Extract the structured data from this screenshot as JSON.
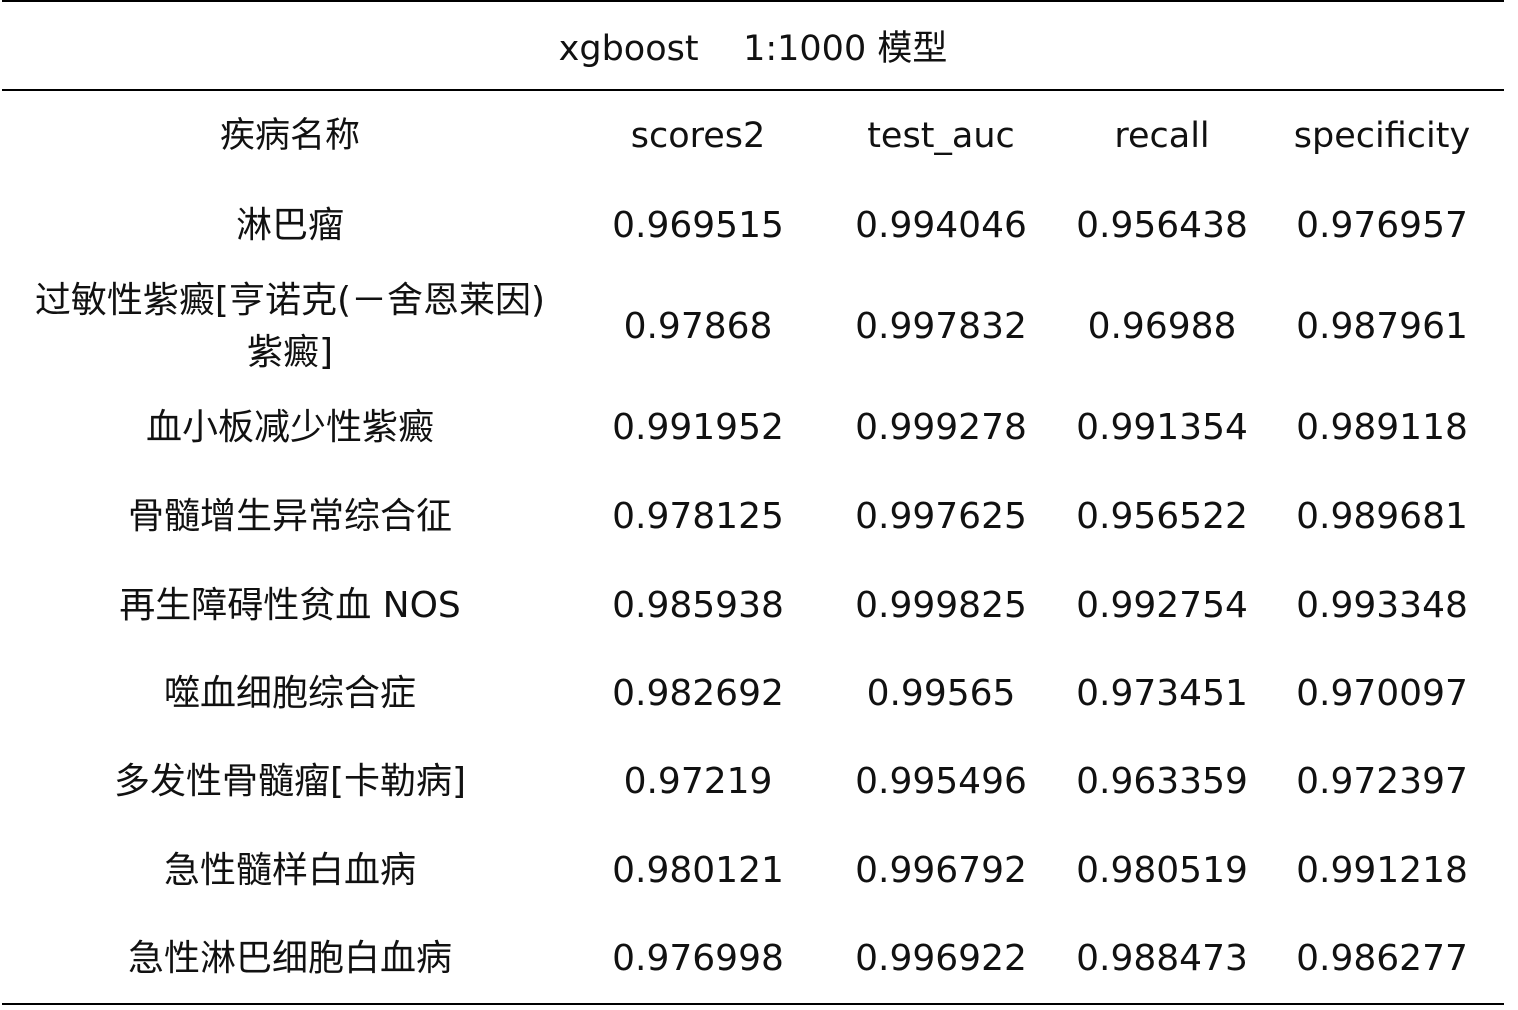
{
  "caption": "xgboost    1:1000 模型",
  "columns": [
    "疾病名称",
    "scores2",
    "test_auc",
    "recall",
    "specificity"
  ],
  "rows": [
    {
      "name": "淋巴瘤",
      "scores2": "0.969515",
      "test_auc": "0.994046",
      "recall": "0.956438",
      "specificity": "0.976957"
    },
    {
      "name": "过敏性紫癜[亨诺克(－舍恩莱因)紫癜]",
      "scores2": "0.97868",
      "test_auc": "0.997832",
      "recall": "0.96988",
      "specificity": "0.987961"
    },
    {
      "name": "血小板减少性紫癜",
      "scores2": "0.991952",
      "test_auc": "0.999278",
      "recall": "0.991354",
      "specificity": "0.989118"
    },
    {
      "name": "骨髓增生异常综合征",
      "scores2": "0.978125",
      "test_auc": "0.997625",
      "recall": "0.956522",
      "specificity": "0.989681"
    },
    {
      "name": "再生障碍性贫血 NOS",
      "scores2": "0.985938",
      "test_auc": "0.999825",
      "recall": "0.992754",
      "specificity": "0.993348"
    },
    {
      "name": "噬血细胞综合症",
      "scores2": "0.982692",
      "test_auc": "0.99565",
      "recall": "0.973451",
      "specificity": "0.970097"
    },
    {
      "name": "多发性骨髓瘤[卡勒病]",
      "scores2": "0.97219",
      "test_auc": "0.995496",
      "recall": "0.963359",
      "specificity": "0.972397"
    },
    {
      "name": "急性髓样白血病",
      "scores2": "0.980121",
      "test_auc": "0.996792",
      "recall": "0.980519",
      "specificity": "0.991218"
    },
    {
      "name": "急性淋巴细胞白血病",
      "scores2": "0.976998",
      "test_auc": "0.996922",
      "recall": "0.988473",
      "specificity": "0.986277"
    }
  ]
}
